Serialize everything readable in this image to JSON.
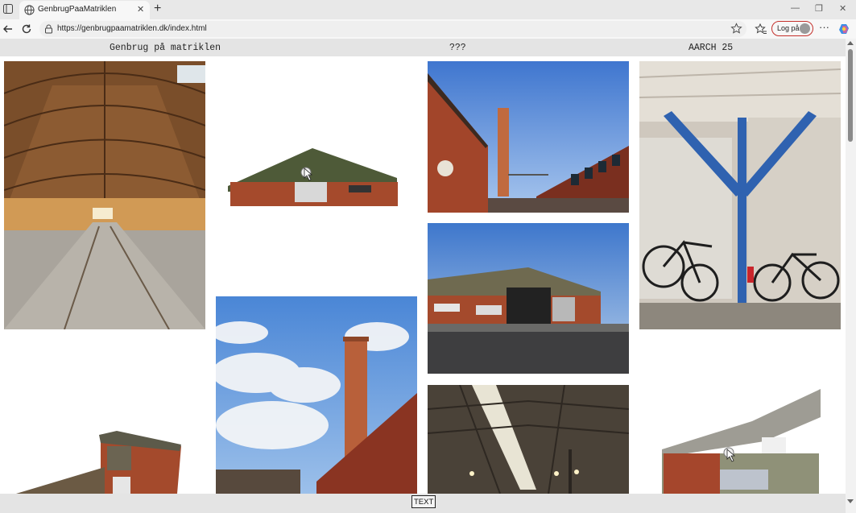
{
  "browser": {
    "tab_title": "GenbrugPaaMatriklen",
    "url": "https://genbrugpaamatriklen.dk/index.html",
    "login_label": "Log på",
    "new_tab": "+",
    "close_tab": "✕",
    "more": "···"
  },
  "header": {
    "left": "Genbrug på matriklen",
    "center": "???",
    "right": "AARCH 25"
  },
  "footer": {
    "button_label": "TEXT"
  },
  "icons": [
    "sidebar-icon",
    "globe-icon",
    "back-icon",
    "refresh-icon",
    "lock-icon",
    "star-icon",
    "favorites-icon",
    "avatar-icon",
    "copilot-icon",
    "minimize-icon",
    "restore-icon",
    "close-icon"
  ],
  "colors": {
    "header_bg": "#e4e4e4",
    "login_border": "#c4302b",
    "brick": "#a2452a",
    "sky": "#5a8fd8"
  }
}
